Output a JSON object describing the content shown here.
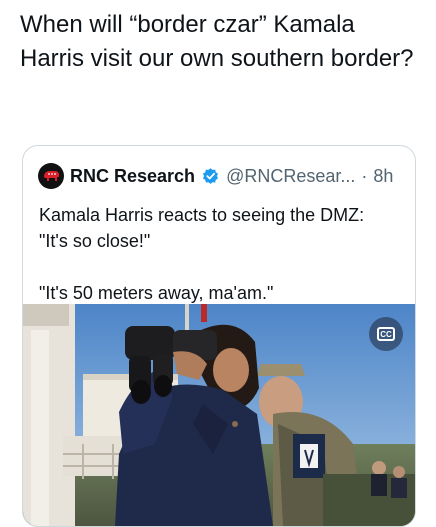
{
  "tweet": {
    "text": "When will “border czar” Kamala Harris visit our own southern border?"
  },
  "quoted_tweet": {
    "author_name": "RNC Research",
    "author_handle": "@RNCResear...",
    "separator": "·",
    "timestamp": "8h",
    "text": "Kamala Harris reacts to seeing the DMZ:\n\"It's so close!\"\n\n\"It's 50 meters away, ma'am.\"",
    "avatar_icon": "rnc-elephant-logo-icon",
    "verified_icon": "verified-badge-icon",
    "verified_color": "#1d9bf0"
  },
  "media": {
    "type": "video-thumbnail",
    "caption_button_label": "CC",
    "caption_icon": "closed-captions-icon"
  }
}
